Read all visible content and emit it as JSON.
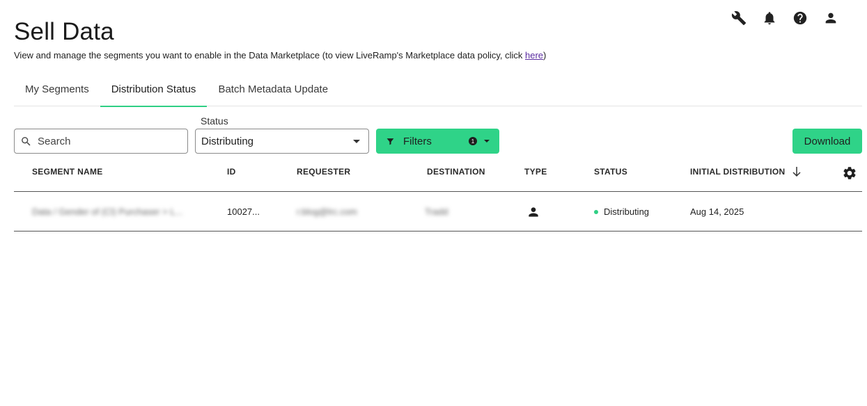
{
  "header": {
    "title": "Sell Data",
    "description_prefix": "View and manage the segments you want to enable in the Data Marketplace (to view LiveRamp's Marketplace data policy, click ",
    "description_link": "here",
    "description_suffix": ")",
    "icons": [
      "wrench-icon",
      "bell-icon",
      "help-icon",
      "user-icon"
    ]
  },
  "tabs": [
    {
      "label": "My Segments",
      "active": false
    },
    {
      "label": "Distribution Status",
      "active": true
    },
    {
      "label": "Batch Metadata Update",
      "active": false
    }
  ],
  "toolbar": {
    "search_placeholder": "Search",
    "status_label": "Status",
    "status_value": "Distributing",
    "filters_label": "Filters",
    "filters_count": "1",
    "download_label": "Download"
  },
  "table": {
    "columns": [
      "SEGMENT NAME",
      "ID",
      "REQUESTER",
      "DESTINATION",
      "TYPE",
      "STATUS",
      "INITIAL DISTRIBUTION"
    ],
    "rows": [
      {
        "segment_name": "Data / Gender of (Cl) Purchaser > L...",
        "id": "10027...",
        "requester": "r.blog@lrc.com",
        "destination": "Tradd",
        "type_icon": "person-icon",
        "status": "Distributing",
        "initial_distribution": "Aug 14, 2025"
      }
    ]
  },
  "colors": {
    "accent": "#2fd388",
    "status_active": "#2fcf84",
    "link": "#5a2ca0"
  }
}
